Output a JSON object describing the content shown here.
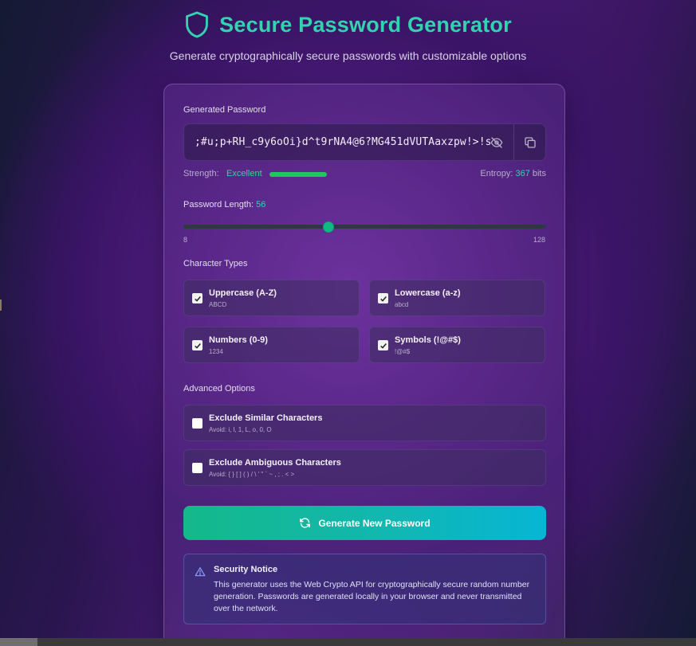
{
  "header": {
    "title": "Secure Password Generator",
    "subtitle": "Generate cryptographically secure passwords with customizable options",
    "icon": "shield-icon"
  },
  "password": {
    "label": "Generated Password",
    "value": ";#u;p+RH_c9y6oOi}d^t9rNA4@6?MG451dVUTAaxzpw!>!s",
    "toggle_icon": "eye-off-icon",
    "copy_icon": "copy-icon"
  },
  "strength": {
    "label": "Strength:",
    "value": "Excellent",
    "level": 1.0,
    "entropy_label": "Entropy:",
    "entropy_value": "367",
    "entropy_unit": "bits"
  },
  "length": {
    "label": "Password Length:",
    "value": "56",
    "min": "8",
    "max": "128"
  },
  "character_types": {
    "heading": "Character Types",
    "items": [
      {
        "label": "Uppercase (A-Z)",
        "sample": "ABCD",
        "checked": true
      },
      {
        "label": "Lowercase (a-z)",
        "sample": "abcd",
        "checked": true
      },
      {
        "label": "Numbers (0-9)",
        "sample": "1234",
        "checked": true
      },
      {
        "label": "Symbols (!@#$)",
        "sample": "!@#$",
        "checked": true
      }
    ]
  },
  "advanced": {
    "heading": "Advanced Options",
    "items": [
      {
        "label": "Exclude Similar Characters",
        "sample": "Avoid: i, l, 1, L, o, 0, O",
        "checked": false
      },
      {
        "label": "Exclude Ambiguous Characters",
        "sample": "Avoid: { } [ ] ( ) / \\ ' \" ` ~ , ; . < >",
        "checked": false
      }
    ]
  },
  "generate_button": {
    "label": "Generate New Password",
    "icon": "refresh-icon"
  },
  "notice": {
    "title": "Security Notice",
    "body": "This generator uses the Web Crypto API for cryptographically secure random number generation. Passwords are generated locally in your browser and never transmitted over the network.",
    "icon": "warning-icon"
  },
  "colors": {
    "accent": "#34d3b0",
    "strength_bar": "#22c55e",
    "button_start": "#14b88a",
    "button_end": "#06b6d4"
  }
}
